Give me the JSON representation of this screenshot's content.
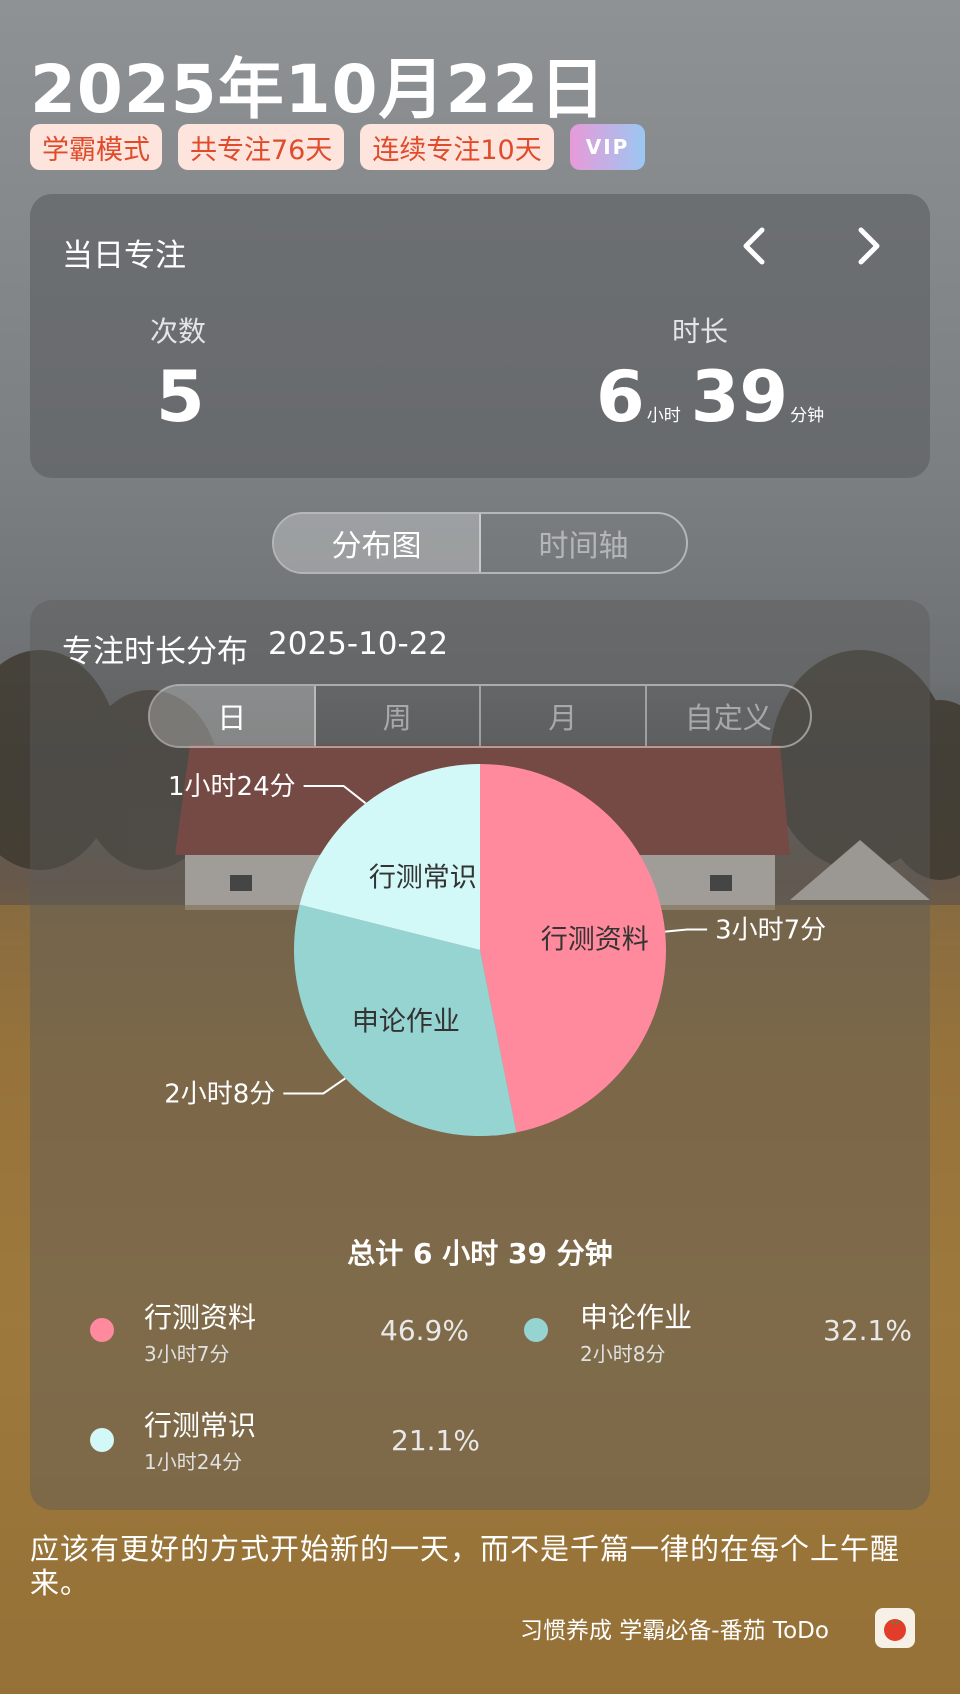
{
  "header": {
    "date": "2025年10月22日",
    "badges": [
      {
        "label": "学霸模式"
      },
      {
        "label": "共专注76天"
      },
      {
        "label": "连续专注10天"
      },
      {
        "label": "VIP"
      }
    ]
  },
  "today_card": {
    "title": "当日专注",
    "count_label": "次数",
    "count_value": "5",
    "duration_label": "时长",
    "hours": "6",
    "hours_unit": "小时",
    "minutes": "39",
    "minutes_unit": "分钟"
  },
  "view_toggle": {
    "tabs": [
      {
        "label": "分布图",
        "active": true
      },
      {
        "label": "时间轴",
        "active": false
      }
    ]
  },
  "distribution": {
    "title": "专注时长分布",
    "date": "2025-10-22",
    "periods": [
      {
        "label": "日",
        "active": true
      },
      {
        "label": "周",
        "active": false
      },
      {
        "label": "月",
        "active": false
      },
      {
        "label": "自定义",
        "active": false
      }
    ],
    "total": "总计 6 小时 39 分钟"
  },
  "chart_data": {
    "type": "pie",
    "slices": [
      {
        "name": "行测资料",
        "duration": "3小时7分",
        "percent": 46.9,
        "percent_label": "46.9%",
        "color": "#ff8a9d"
      },
      {
        "name": "申论作业",
        "duration": "2小时8分",
        "percent": 32.1,
        "percent_label": "32.1%",
        "color": "#96d4d2"
      },
      {
        "name": "行测常识",
        "duration": "1小时24分",
        "percent": 21.1,
        "percent_label": "21.1%",
        "color": "#d2f8f7"
      }
    ]
  },
  "quote": "应该有更好的方式开始新的一天，而不是千篇一律的在每个上午醒来。",
  "footer": {
    "text": "习惯养成 学霸必备-番茄 ToDo",
    "icon": "tomato-icon"
  }
}
